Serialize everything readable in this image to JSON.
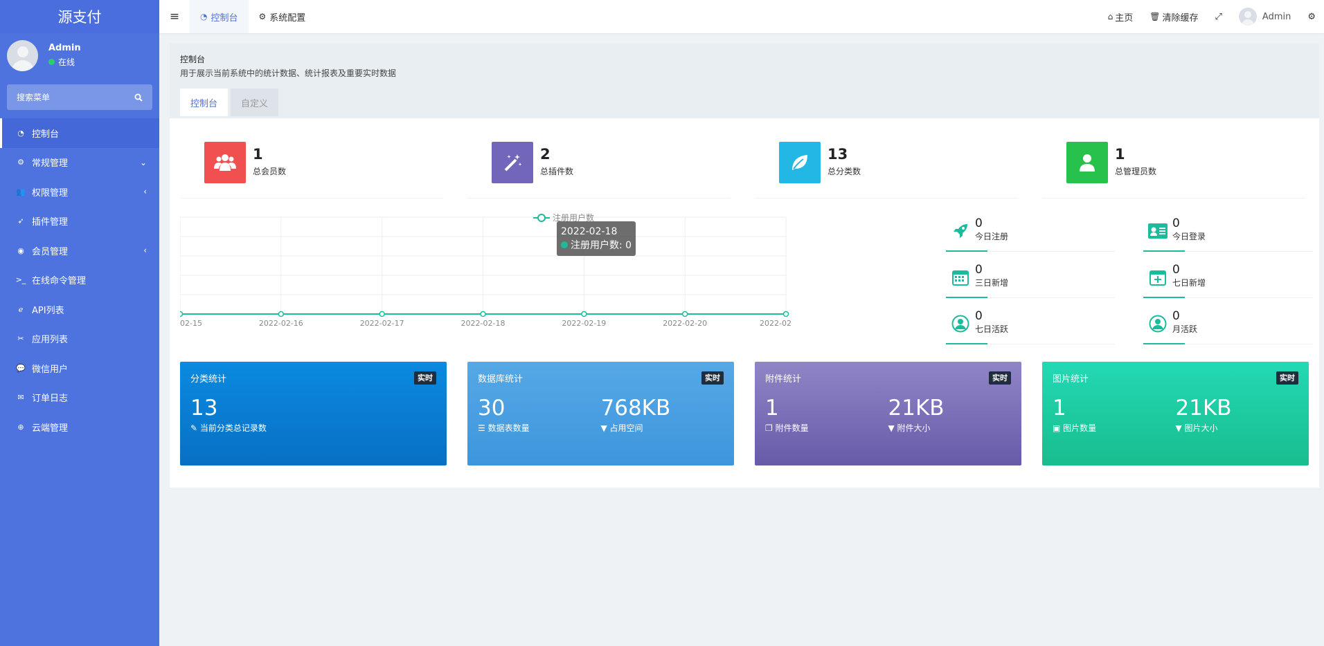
{
  "app": {
    "logo": "源支付"
  },
  "user": {
    "name": "Admin",
    "status": "在线"
  },
  "search": {
    "placeholder": "搜索菜单"
  },
  "sidebar": {
    "items": [
      {
        "label": "控制台",
        "icon": "dashboard-icon"
      },
      {
        "label": "常规管理",
        "icon": "cogs-icon"
      },
      {
        "label": "权限管理",
        "icon": "group-icon"
      },
      {
        "label": "插件管理",
        "icon": "rocket-icon"
      },
      {
        "label": "会员管理",
        "icon": "user-circle-icon"
      },
      {
        "label": "在线命令管理",
        "icon": "terminal-icon"
      },
      {
        "label": "API列表",
        "icon": "api-icon"
      },
      {
        "label": "应用列表",
        "icon": "app-icon"
      },
      {
        "label": "微信用户",
        "icon": "wechat-icon"
      },
      {
        "label": "订单日志",
        "icon": "envelope-icon"
      },
      {
        "label": "云端管理",
        "icon": "cloud-icon"
      }
    ]
  },
  "topbar": {
    "tabs": [
      "控制台",
      "系统配置"
    ],
    "home": "主页",
    "clear_cache": "清除缓存",
    "admin": "Admin"
  },
  "header": {
    "title": "控制台",
    "subtitle": "用于展示当前系统中的统计数据、统计报表及重要实时数据",
    "tabs": [
      "控制台",
      "自定义"
    ]
  },
  "stats": [
    {
      "value": "1",
      "label": "总会员数",
      "color": "#f05050"
    },
    {
      "value": "2",
      "label": "总插件数",
      "color": "#7266ba"
    },
    {
      "value": "13",
      "label": "总分类数",
      "color": "#23b7e5"
    },
    {
      "value": "1",
      "label": "总管理员数",
      "color": "#27c24c"
    }
  ],
  "mini_stats": [
    {
      "value": "0",
      "label": "今日注册"
    },
    {
      "value": "0",
      "label": "今日登录"
    },
    {
      "value": "0",
      "label": "三日新增"
    },
    {
      "value": "0",
      "label": "七日新增"
    },
    {
      "value": "0",
      "label": "七日活跃"
    },
    {
      "value": "0",
      "label": "月活跃"
    }
  ],
  "tooltip": {
    "date": "2022-02-18",
    "text": "注册用户数: 0"
  },
  "chart_data": {
    "type": "line",
    "x_labels": [
      "02-15",
      "2022-02-16",
      "2022-02-17",
      "2022-02-18",
      "2022-02-19",
      "2022-02-20",
      "2022-02"
    ],
    "series": [
      {
        "name": "注册用户数",
        "values": [
          0,
          0,
          0,
          0,
          0,
          0,
          0
        ],
        "color": "#1abc9c"
      }
    ]
  },
  "cards": [
    {
      "title": "分类统计",
      "badge": "实时",
      "colA": {
        "value": "13",
        "label": "当前分类总记录数"
      },
      "bg": "linear-gradient(180deg,#0a8ae0,#0870c4)"
    },
    {
      "title": "数据库统计",
      "badge": "实时",
      "colA": {
        "value": "30",
        "label": "数据表数量"
      },
      "colB": {
        "value": "768KB",
        "label": "占用空间"
      },
      "bg": "linear-gradient(180deg,#56a8e6,#3d96dc)"
    },
    {
      "title": "附件统计",
      "badge": "实时",
      "colA": {
        "value": "1",
        "label": "附件数量"
      },
      "colB": {
        "value": "21KB",
        "label": "附件大小"
      },
      "bg": "linear-gradient(180deg,#9085c6,#675ba9)"
    },
    {
      "title": "图片统计",
      "badge": "实时",
      "colA": {
        "value": "1",
        "label": "图片数量"
      },
      "colB": {
        "value": "21KB",
        "label": "图片大小"
      },
      "bg": "linear-gradient(180deg,#23d9b5,#18bd8d)"
    }
  ]
}
